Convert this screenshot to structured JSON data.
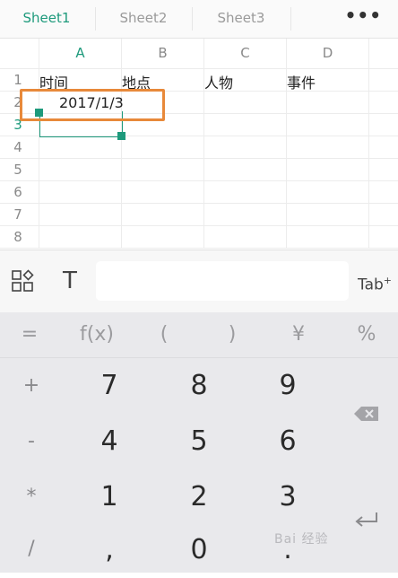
{
  "sheet_tabs": {
    "tabs": [
      {
        "label": "Sheet1"
      },
      {
        "label": "Sheet2"
      },
      {
        "label": "Sheet3"
      }
    ],
    "more_label": "•••"
  },
  "grid": {
    "columns": [
      "A",
      "B",
      "C",
      "D"
    ],
    "rows": [
      "1",
      "2",
      "3",
      "4",
      "5",
      "6",
      "7",
      "8"
    ],
    "cells": {
      "A1": "时间",
      "B1": "地点",
      "C1": "人物",
      "D1": "事件",
      "A2": "2017/1/3"
    }
  },
  "toolbar": {
    "text_icon_label": "T",
    "formula_value": "",
    "tab_label": "Tab"
  },
  "keypad": {
    "function_keys": [
      "=",
      "f(x)",
      "(",
      ")",
      "¥",
      "%"
    ],
    "digits": [
      "7",
      "8",
      "9",
      "4",
      "5",
      "6",
      "1",
      "2",
      "3",
      ",",
      "0",
      "."
    ],
    "operators": [
      "+",
      "-",
      "*",
      "/"
    ]
  },
  "watermark": "Bai 经验",
  "colors": {
    "accent": "#1e9a7c",
    "highlight": "#e8893a"
  }
}
